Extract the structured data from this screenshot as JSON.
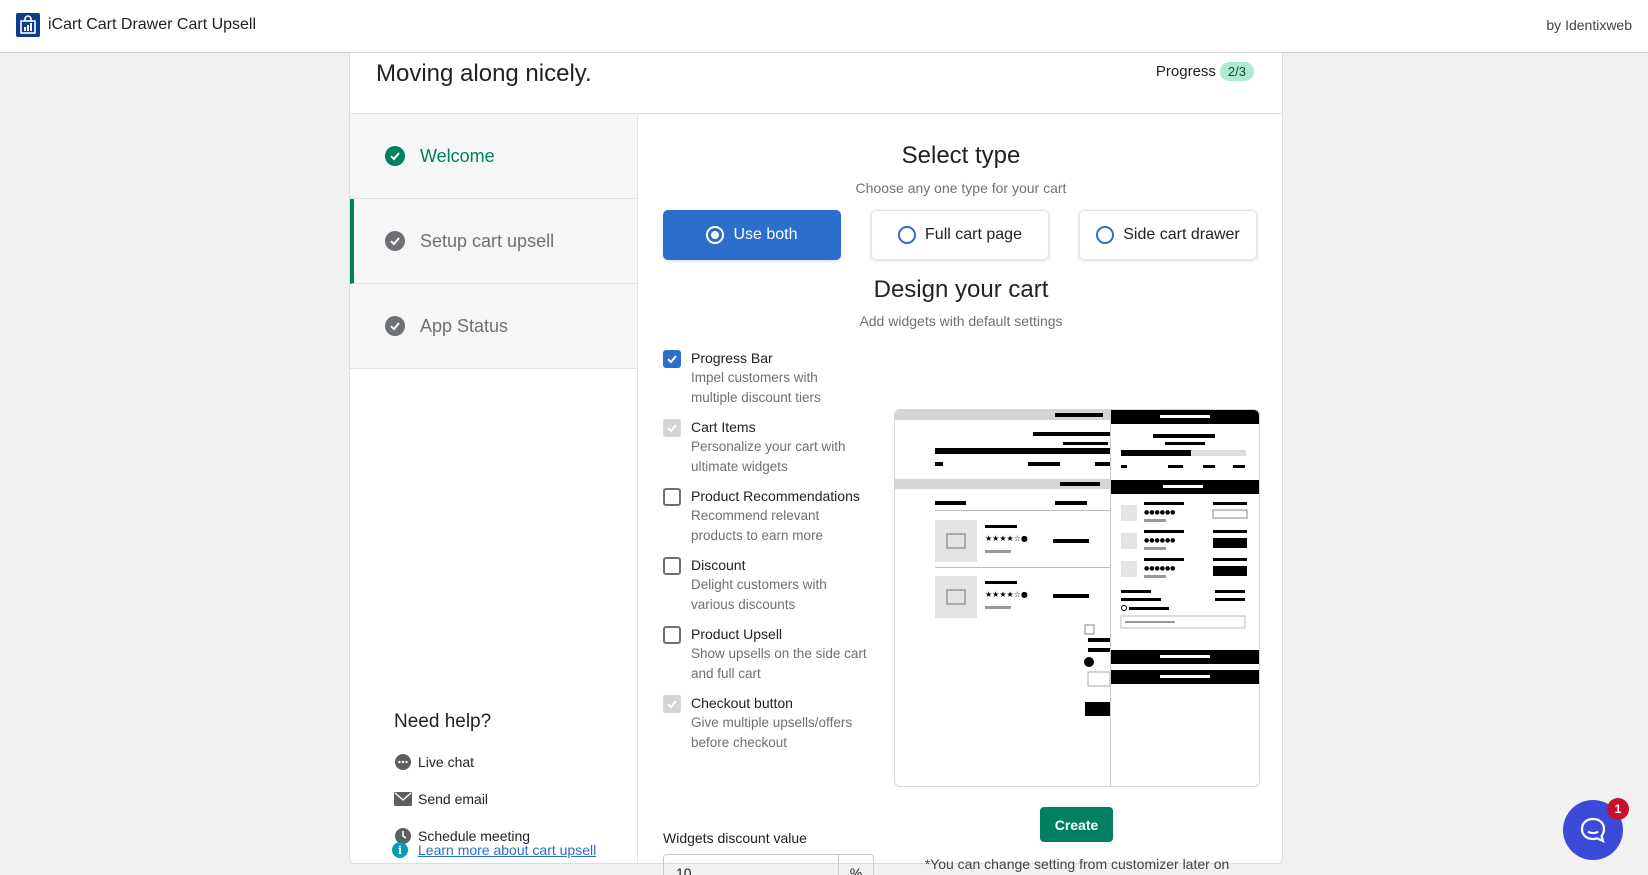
{
  "app": {
    "title": "iCart Cart Drawer Cart Upsell",
    "vendor": "by Identixweb",
    "brand_color": "#0d3d8a"
  },
  "header": {
    "title": "Moving along nicely.",
    "progress_label": "Progress",
    "progress_badge": "2/3",
    "progress_value": 0.667
  },
  "steps": [
    {
      "label": "Welcome",
      "status": "done"
    },
    {
      "label": "Setup cart upsell",
      "status": "active"
    },
    {
      "label": "App Status",
      "status": "pending"
    }
  ],
  "help": {
    "title": "Need help?",
    "items": [
      {
        "label": "Live chat",
        "icon": "chat-icon"
      },
      {
        "label": "Send email",
        "icon": "mail-icon"
      },
      {
        "label": "Schedule meeting",
        "icon": "clock-icon"
      }
    ],
    "learn_more": "Learn more about cart upsell"
  },
  "select_type": {
    "title": "Select type",
    "subtitle": "Choose any one type for your cart",
    "options": [
      {
        "label": "Use both",
        "selected": true
      },
      {
        "label": "Full cart page",
        "selected": false
      },
      {
        "label": "Side cart drawer",
        "selected": false
      }
    ]
  },
  "design": {
    "title": "Design your cart",
    "subtitle": "Add widgets with default settings",
    "widgets": [
      {
        "label": "Progress Bar",
        "desc1": "Impel customers with",
        "desc2": "multiple discount tiers",
        "state": "checked"
      },
      {
        "label": "Cart Items",
        "desc1": "Personalize your cart with",
        "desc2": "ultimate widgets",
        "state": "disabled"
      },
      {
        "label": "Product Recommendations",
        "desc1": "Recommend relevant",
        "desc2": "products to earn more",
        "state": "unchecked"
      },
      {
        "label": "Discount",
        "desc1": "Delight customers with",
        "desc2": "various discounts",
        "state": "unchecked"
      },
      {
        "label": "Product Upsell",
        "desc1": "Show upsells on the side cart",
        "desc2": "and full cart",
        "state": "unchecked"
      },
      {
        "label": "Checkout button",
        "desc1": "Give multiple upsells/offers",
        "desc2": "before checkout",
        "state": "disabled"
      }
    ],
    "discount_label": "Widgets discount value",
    "discount_value": "10",
    "discount_suffix": "%",
    "create_label": "Create",
    "note": "*You can change setting from customizer later on"
  },
  "chat": {
    "badge": "1",
    "color": "#3b4bd8"
  },
  "colors": {
    "primary": "#2c6ecb",
    "success": "#008060",
    "badge_bg": "#aee9d1"
  }
}
